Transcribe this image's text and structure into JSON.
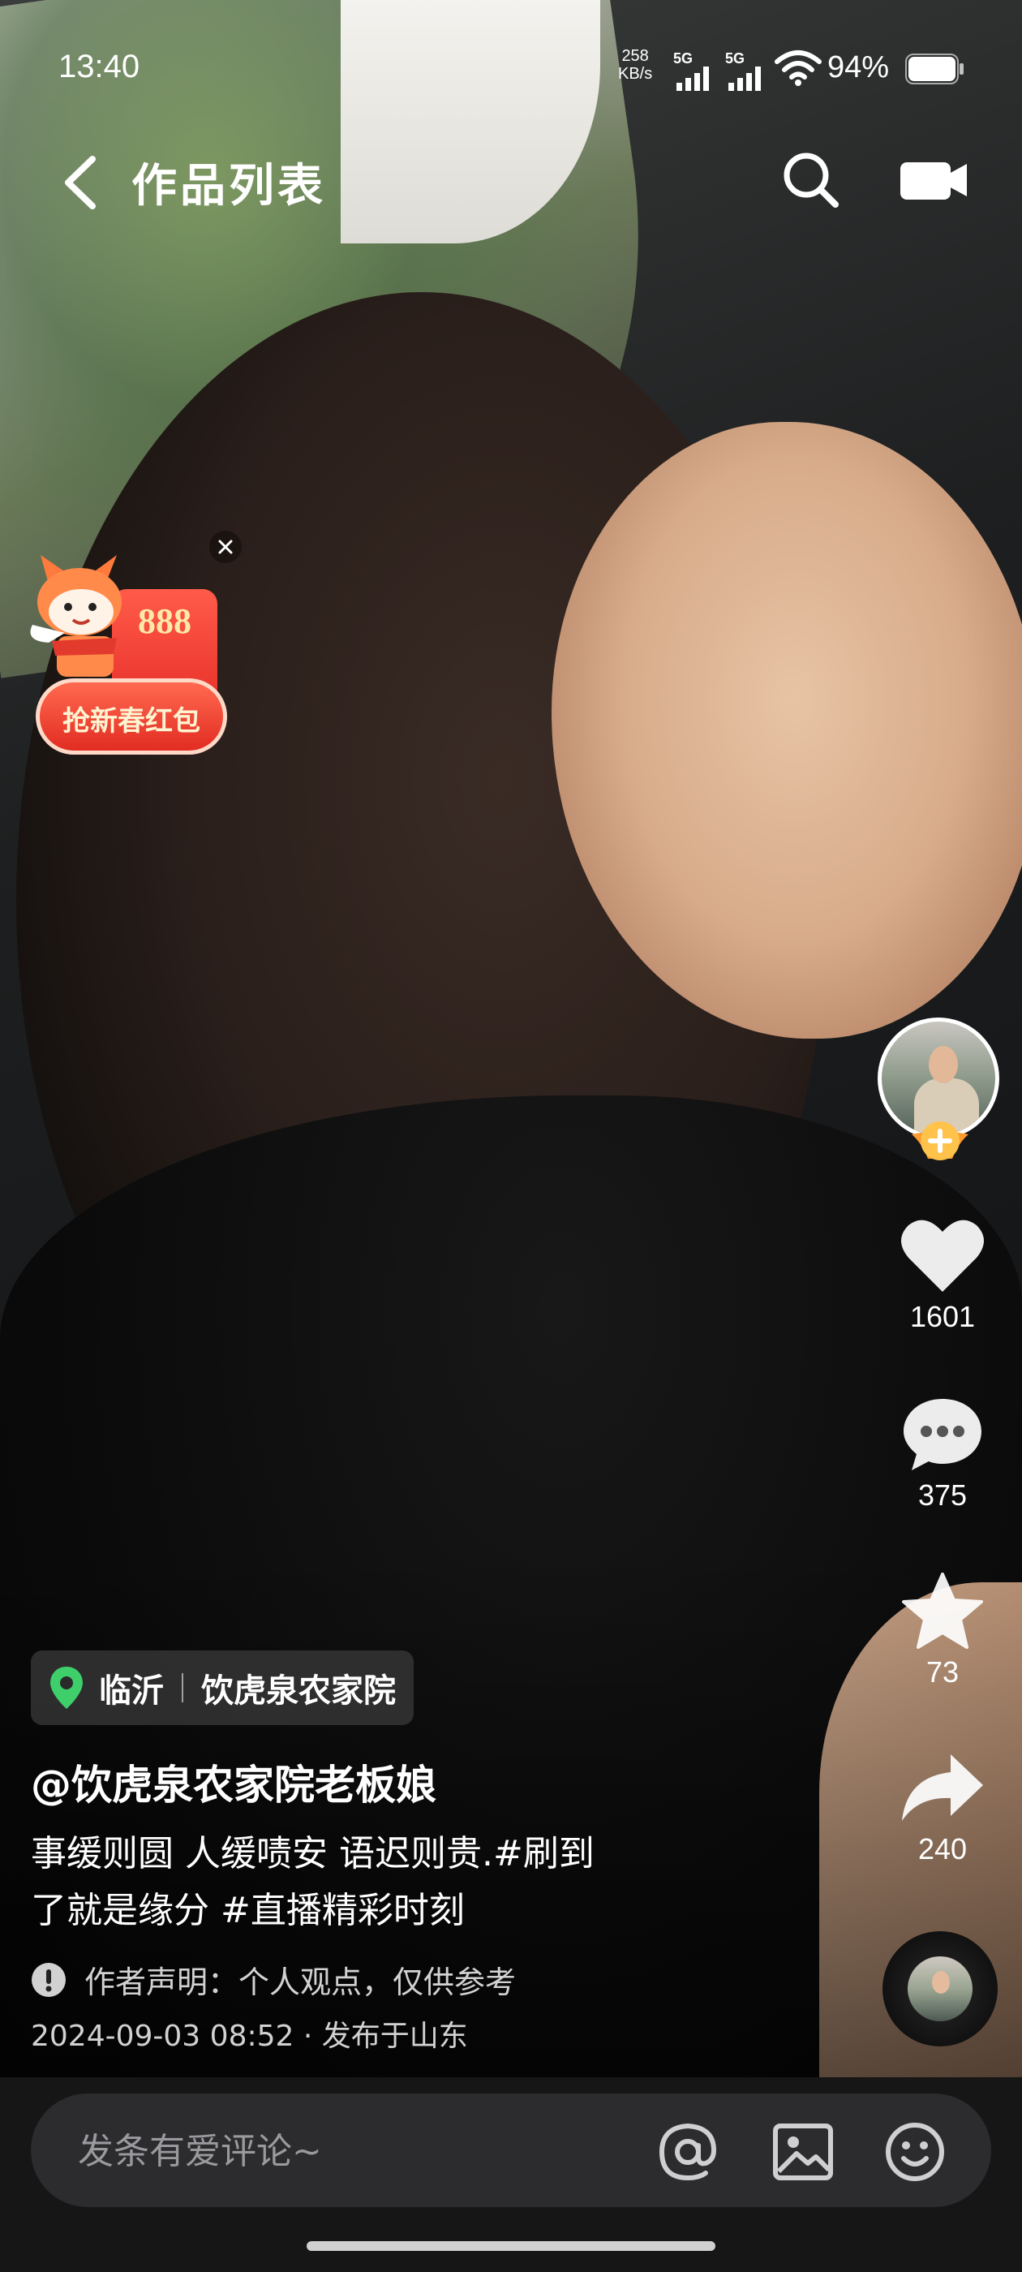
{
  "status_bar": {
    "time": "13:40",
    "net_speed_value": "258",
    "net_speed_unit": "KB/s",
    "sim1": "5G",
    "sim2": "5G",
    "battery": "94%"
  },
  "nav": {
    "title": "作品列表",
    "back_icon": "chevron-left-icon",
    "search_icon": "search-icon",
    "camera_icon": "video-camera-icon"
  },
  "red_packet": {
    "amount": "888",
    "label": "抢新春红包",
    "colors": {
      "primary": "#e9322b",
      "text": "#fff3d0"
    }
  },
  "actions": {
    "likes": "1601",
    "comments": "375",
    "favorites": "73",
    "shares": "240"
  },
  "post": {
    "location_city": "临沂",
    "location_place": "饮虎泉农家院",
    "author": "@饮虎泉农家院老板娘",
    "caption_line1": "事缓则圆 人缓啧安 语迟则贵.#刷到",
    "caption_line2": "了就是缘分 #直播精彩时刻",
    "disclaimer": "作者声明：个人观点，仅供参考",
    "meta": "2024-09-03 08:52 · 发布于山东"
  },
  "comment_bar": {
    "placeholder": "发条有爱评论~"
  },
  "colors": {
    "location_pin": "#3ecf6b",
    "follow_badge": "#ffb23f",
    "comment_bar_bg": "#2c2c2e"
  }
}
